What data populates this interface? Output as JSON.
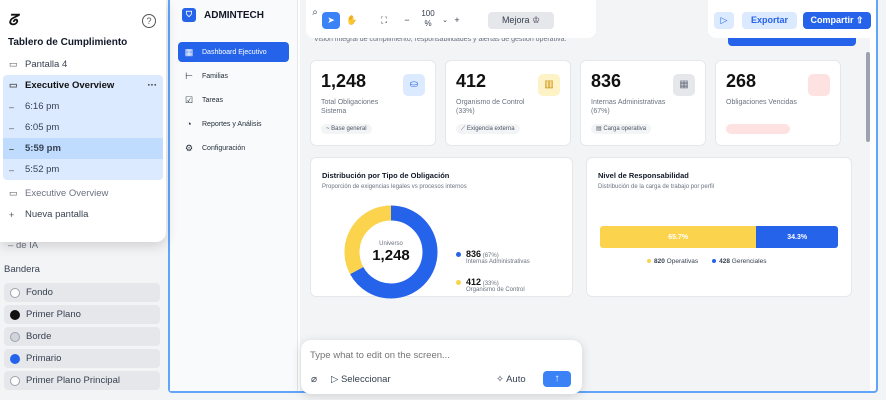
{
  "popup": {
    "title": "Tablero de Cumplimiento",
    "logo": "ᘔ",
    "items": [
      {
        "label": "Pantalla 4"
      }
    ],
    "group": {
      "head": "Executive Overview",
      "more": "···",
      "versions": [
        "6:16 pm",
        "6:05 pm",
        "5:59 pm",
        "5:52 pm"
      ]
    },
    "after": [
      {
        "label": "Executive Overview"
      },
      {
        "label": "Nueva pantalla"
      }
    ]
  },
  "underlay": {
    "partial": "de IA",
    "section": "Bandera",
    "options": [
      "Fondo",
      "Primer Plano",
      "Borde",
      "Primario",
      "Primer Plano Principal"
    ]
  },
  "nav": {
    "brand": "ADMINTECH",
    "items": [
      "Dashboard Ejecutivo",
      "Familias",
      "Tareas",
      "Reportes y Análisis",
      "Configuración"
    ]
  },
  "main": {
    "subtitle": "Visión integral de cumplimiento, responsabilidades y alertas de gestión operativa."
  },
  "stats": [
    {
      "value": "1,248",
      "label": "Total Obligaciones Sistema",
      "tag": "~ Base general",
      "icon": "briefcase-icon",
      "color": "#2563eb",
      "bg": "#dbeafe"
    },
    {
      "value": "412",
      "label": "Organismo de Control (33%)",
      "tag": "⟋ Exigencia externa",
      "icon": "building-icon",
      "color": "#ca8a04",
      "bg": "#fef3c7"
    },
    {
      "value": "836",
      "label": "Internas Administrativas (67%)",
      "tag": "▤ Carga operativa",
      "icon": "office-icon",
      "color": "#6b7280",
      "bg": "#e5e7eb"
    },
    {
      "value": "268",
      "label": "Obligaciones Vencidas",
      "tag": "",
      "icon": "alert-icon",
      "color": "#ef4444",
      "bg": "#fee2e2"
    }
  ],
  "donut": {
    "title": "Distribución por Tipo de Obligación",
    "subtitle": "Proporción de exigencias legales vs procesos internos",
    "center_label": "Universo",
    "center_value": "1,248",
    "legend": [
      {
        "value": "836",
        "pct": "(67%)",
        "name": "Internas Administrativas",
        "color": "#2563eb"
      },
      {
        "value": "412",
        "pct": "(33%)",
        "name": "Organismo de Control",
        "color": "#fcd34d"
      }
    ]
  },
  "bar": {
    "title": "Nivel de Responsabilidad",
    "subtitle": "Distribución de la carga de trabajo por perfil",
    "left_pct": "65.7%",
    "right_pct": "34.3%",
    "left_fraction": 0.657,
    "legend": [
      {
        "value": "820",
        "name": "Operativas",
        "color": "#fcd34d"
      },
      {
        "value": "428",
        "name": "Gerenciales",
        "color": "#2563eb"
      }
    ]
  },
  "toolbar": {
    "zoom": "100",
    "zoom_unit": "%",
    "minus": "−",
    "plus": "+",
    "improve": "Mejora",
    "export": "Exportar",
    "share": "Compartir"
  },
  "prompt": {
    "placeholder": "Type what to edit on the screen...",
    "select": "Seleccionar",
    "auto": "Auto"
  },
  "colors": {
    "accent": "#2563eb",
    "yellow": "#fcd34d",
    "selected": "#bfdbfe"
  }
}
